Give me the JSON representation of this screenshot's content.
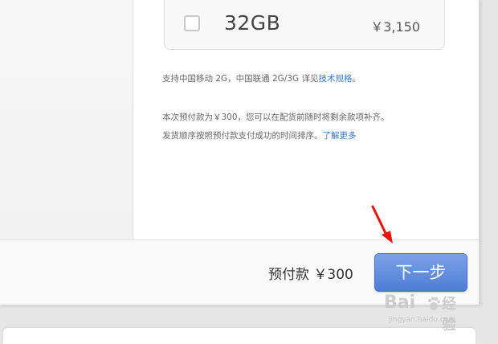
{
  "option": {
    "capacity": "32GB",
    "price": "￥3,150",
    "checked": false
  },
  "notes": {
    "network_prefix": "支持中国移动 2G，中国联通 2G/3G 详见",
    "network_link": "技术规格",
    "network_suffix": "。",
    "deposit_line1": "本次预付款为￥300，您可以在配货前随时将剩余款项补齐。",
    "deposit_line2": "发货顺序按照预付款支付成功的时间排序。",
    "learn_more_link": "了解更多"
  },
  "footer": {
    "deposit_label": "预付款 ￥300",
    "next_button": "下一步"
  },
  "watermark": {
    "logo": "Bai",
    "logo_cn": "经验",
    "site": "jingyan.baidu.com"
  },
  "colors": {
    "accent": "#4f7dd6",
    "link": "#3778cd",
    "annotation_arrow": "#e8140c"
  },
  "icons": [
    "checkbox-icon",
    "red-arrow-icon",
    "baidu-paw-icon"
  ]
}
